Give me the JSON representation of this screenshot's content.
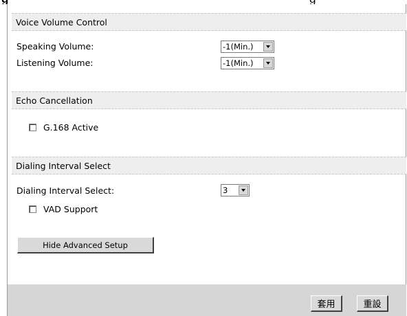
{
  "header_fragment": {
    "left": "g",
    "right": "g"
  },
  "sections": {
    "voice": {
      "title": "Voice Volume Control",
      "speaking_label": "Speaking Volume:",
      "speaking_value": "-1(Min.)",
      "listening_label": "Listening Volume:",
      "listening_value": "-1(Min.)"
    },
    "echo": {
      "title": "Echo Cancellation",
      "g168_label": "G.168 Active",
      "g168_checked": false
    },
    "dialing": {
      "title": "Dialing Interval Select",
      "interval_label": "Dialing Interval Select:",
      "interval_value": "3",
      "vad_label": "VAD Support",
      "vad_checked": false
    }
  },
  "buttons": {
    "hide_advanced": "Hide Advanced Setup",
    "apply": "套用",
    "reset": "重設"
  }
}
